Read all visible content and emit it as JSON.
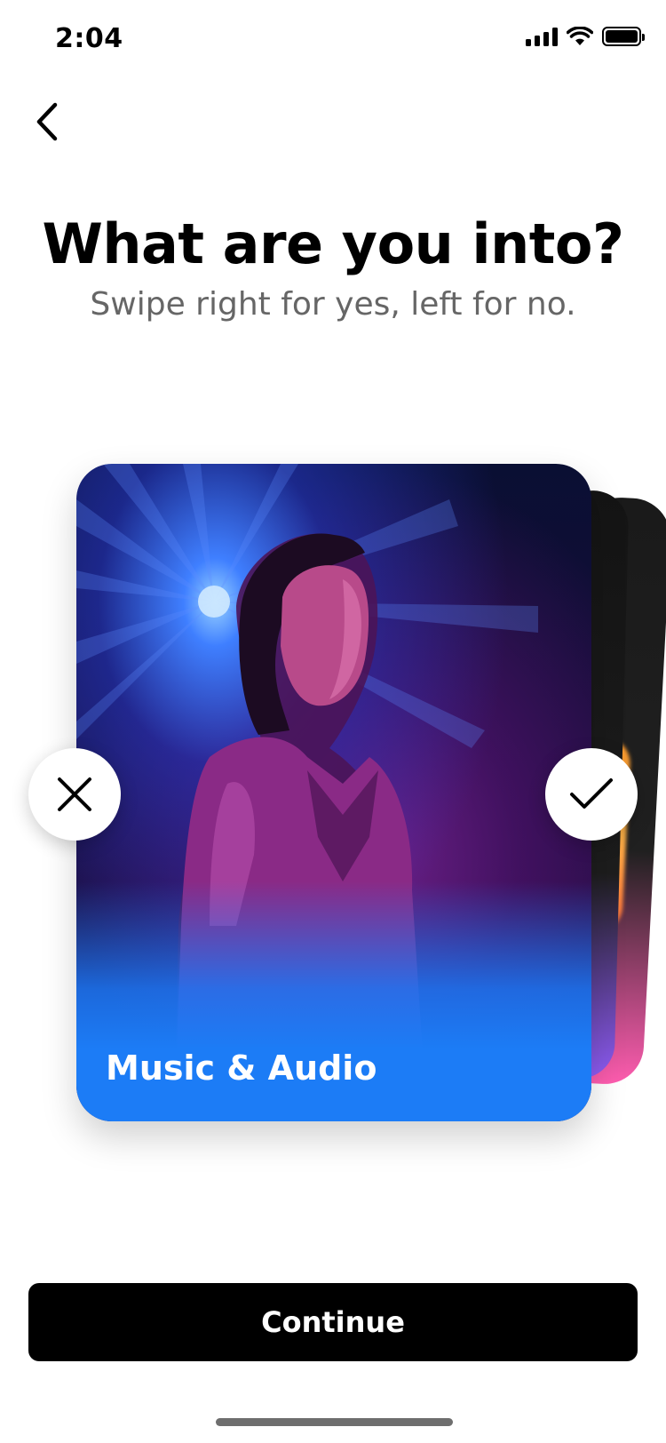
{
  "status_bar": {
    "time": "2:04"
  },
  "header": {
    "title": "What are you into?",
    "subtitle": "Swipe right for yes, left for no."
  },
  "card": {
    "label": "Music & Audio"
  },
  "actions": {
    "continue_label": "Continue"
  },
  "icons": {
    "back": "chevron-left-icon",
    "reject": "close-icon",
    "accept": "checkmark-icon"
  },
  "colors": {
    "card_gradient": "#1c7cf6",
    "button_bg": "#000000",
    "subtitle": "#666666"
  }
}
